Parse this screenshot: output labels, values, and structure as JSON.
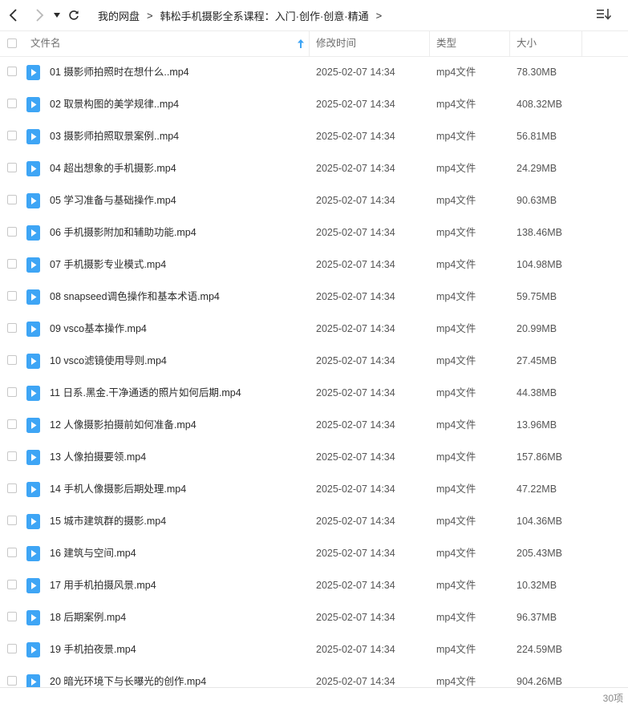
{
  "toolbar": {
    "back_icon": "chevron-left-icon",
    "forward_icon": "chevron-right-icon",
    "history_icon": "caret-down-icon",
    "refresh_icon": "refresh-icon",
    "sort_icon": "sort-list-icon"
  },
  "breadcrumb": {
    "root": "我的网盘",
    "current": "韩松手机摄影全系课程：入门·创作·创意·精通",
    "trailing_sep": ">"
  },
  "columns": {
    "name": "文件名",
    "modified": "修改时间",
    "type": "类型",
    "size": "大小"
  },
  "colors": {
    "accent": "#3ea5f5",
    "file_icon": "#3ea5f5",
    "text": "#2b2b2b",
    "muted": "#6d6d6d"
  },
  "files": [
    {
      "name": "01 摄影师拍照时在想什么..mp4",
      "modified": "2025-02-07 14:34",
      "type": "mp4文件",
      "size": "78.30MB"
    },
    {
      "name": "02 取景构图的美学规律..mp4",
      "modified": "2025-02-07 14:34",
      "type": "mp4文件",
      "size": "408.32MB"
    },
    {
      "name": "03 摄影师拍照取景案例..mp4",
      "modified": "2025-02-07 14:34",
      "type": "mp4文件",
      "size": "56.81MB"
    },
    {
      "name": "04 超出想象的手机摄影.mp4",
      "modified": "2025-02-07 14:34",
      "type": "mp4文件",
      "size": "24.29MB"
    },
    {
      "name": "05 学习准备与基础操作.mp4",
      "modified": "2025-02-07 14:34",
      "type": "mp4文件",
      "size": "90.63MB"
    },
    {
      "name": "06 手机摄影附加和辅助功能.mp4",
      "modified": "2025-02-07 14:34",
      "type": "mp4文件",
      "size": "138.46MB"
    },
    {
      "name": "07 手机摄影专业模式.mp4",
      "modified": "2025-02-07 14:34",
      "type": "mp4文件",
      "size": "104.98MB"
    },
    {
      "name": "08 snapseed调色操作和基本术语.mp4",
      "modified": "2025-02-07 14:34",
      "type": "mp4文件",
      "size": "59.75MB"
    },
    {
      "name": "09 vsco基本操作.mp4",
      "modified": "2025-02-07 14:34",
      "type": "mp4文件",
      "size": "20.99MB"
    },
    {
      "name": "10 vsco滤镜使用导则.mp4",
      "modified": "2025-02-07 14:34",
      "type": "mp4文件",
      "size": "27.45MB"
    },
    {
      "name": "11 日系.黑金.干净通透的照片如何后期.mp4",
      "modified": "2025-02-07 14:34",
      "type": "mp4文件",
      "size": "44.38MB"
    },
    {
      "name": "12 人像摄影拍摄前如何准备.mp4",
      "modified": "2025-02-07 14:34",
      "type": "mp4文件",
      "size": "13.96MB"
    },
    {
      "name": "13 人像拍摄要领.mp4",
      "modified": "2025-02-07 14:34",
      "type": "mp4文件",
      "size": "157.86MB"
    },
    {
      "name": "14 手机人像摄影后期处理.mp4",
      "modified": "2025-02-07 14:34",
      "type": "mp4文件",
      "size": "47.22MB"
    },
    {
      "name": "15 城市建筑群的摄影.mp4",
      "modified": "2025-02-07 14:34",
      "type": "mp4文件",
      "size": "104.36MB"
    },
    {
      "name": "16 建筑与空间.mp4",
      "modified": "2025-02-07 14:34",
      "type": "mp4文件",
      "size": "205.43MB"
    },
    {
      "name": "17 用手机拍摄风景.mp4",
      "modified": "2025-02-07 14:34",
      "type": "mp4文件",
      "size": "10.32MB"
    },
    {
      "name": "18 后期案例.mp4",
      "modified": "2025-02-07 14:34",
      "type": "mp4文件",
      "size": "96.37MB"
    },
    {
      "name": "19 手机拍夜景.mp4",
      "modified": "2025-02-07 14:34",
      "type": "mp4文件",
      "size": "224.59MB"
    },
    {
      "name": "20 暗光环境下与长曝光的创作.mp4",
      "modified": "2025-02-07 14:34",
      "type": "mp4文件",
      "size": "904.26MB"
    }
  ],
  "footer": {
    "count": "30项"
  }
}
